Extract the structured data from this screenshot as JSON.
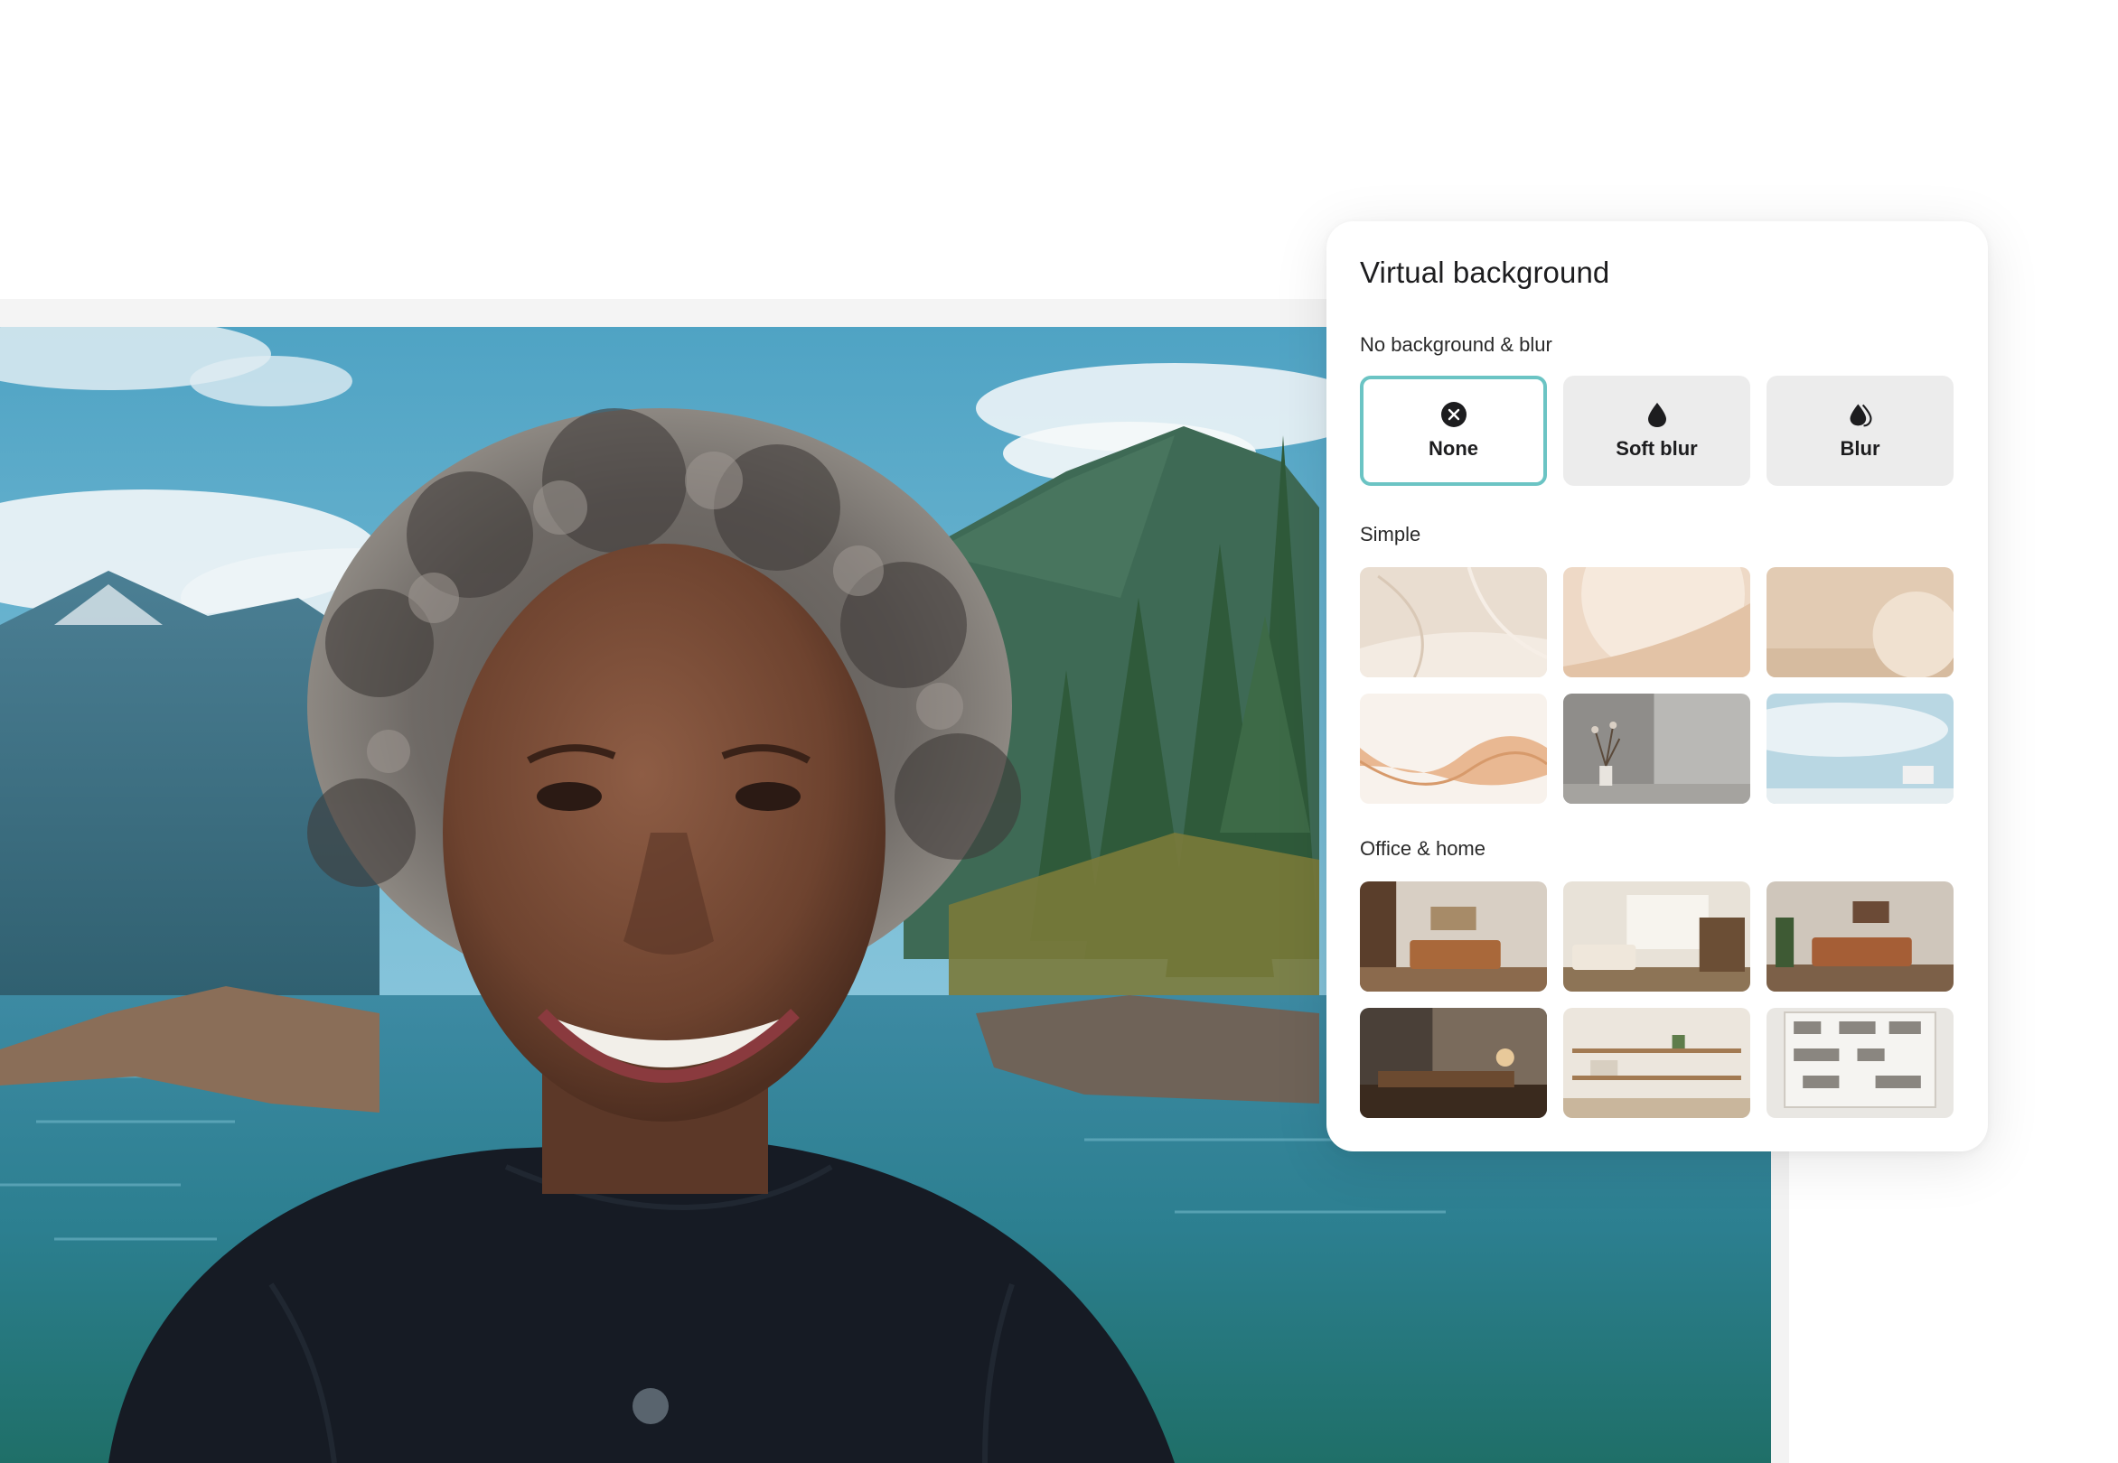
{
  "panel": {
    "title": "Virtual background",
    "sections": {
      "blur": {
        "label": "No background & blur",
        "options": [
          {
            "label": "None",
            "icon": "close-circle-icon",
            "selected": true
          },
          {
            "label": "Soft blur",
            "icon": "droplet-icon",
            "selected": false
          },
          {
            "label": "Blur",
            "icon": "double-droplet-icon",
            "selected": false
          }
        ]
      },
      "simple": {
        "label": "Simple",
        "thumbnails": [
          "beige-curves",
          "beige-sphere",
          "beige-circle",
          "peach-waves",
          "grey-wall-vase",
          "blue-sky-chair"
        ]
      },
      "office": {
        "label": "Office & home",
        "thumbnails": [
          "living-room-1",
          "living-room-bright",
          "living-room-2",
          "dark-study",
          "wood-shelves",
          "white-bookcase"
        ]
      }
    }
  },
  "colors": {
    "selected_border": "#6bc4c4",
    "option_bg": "#ececec",
    "text": "#1d1d1f"
  }
}
